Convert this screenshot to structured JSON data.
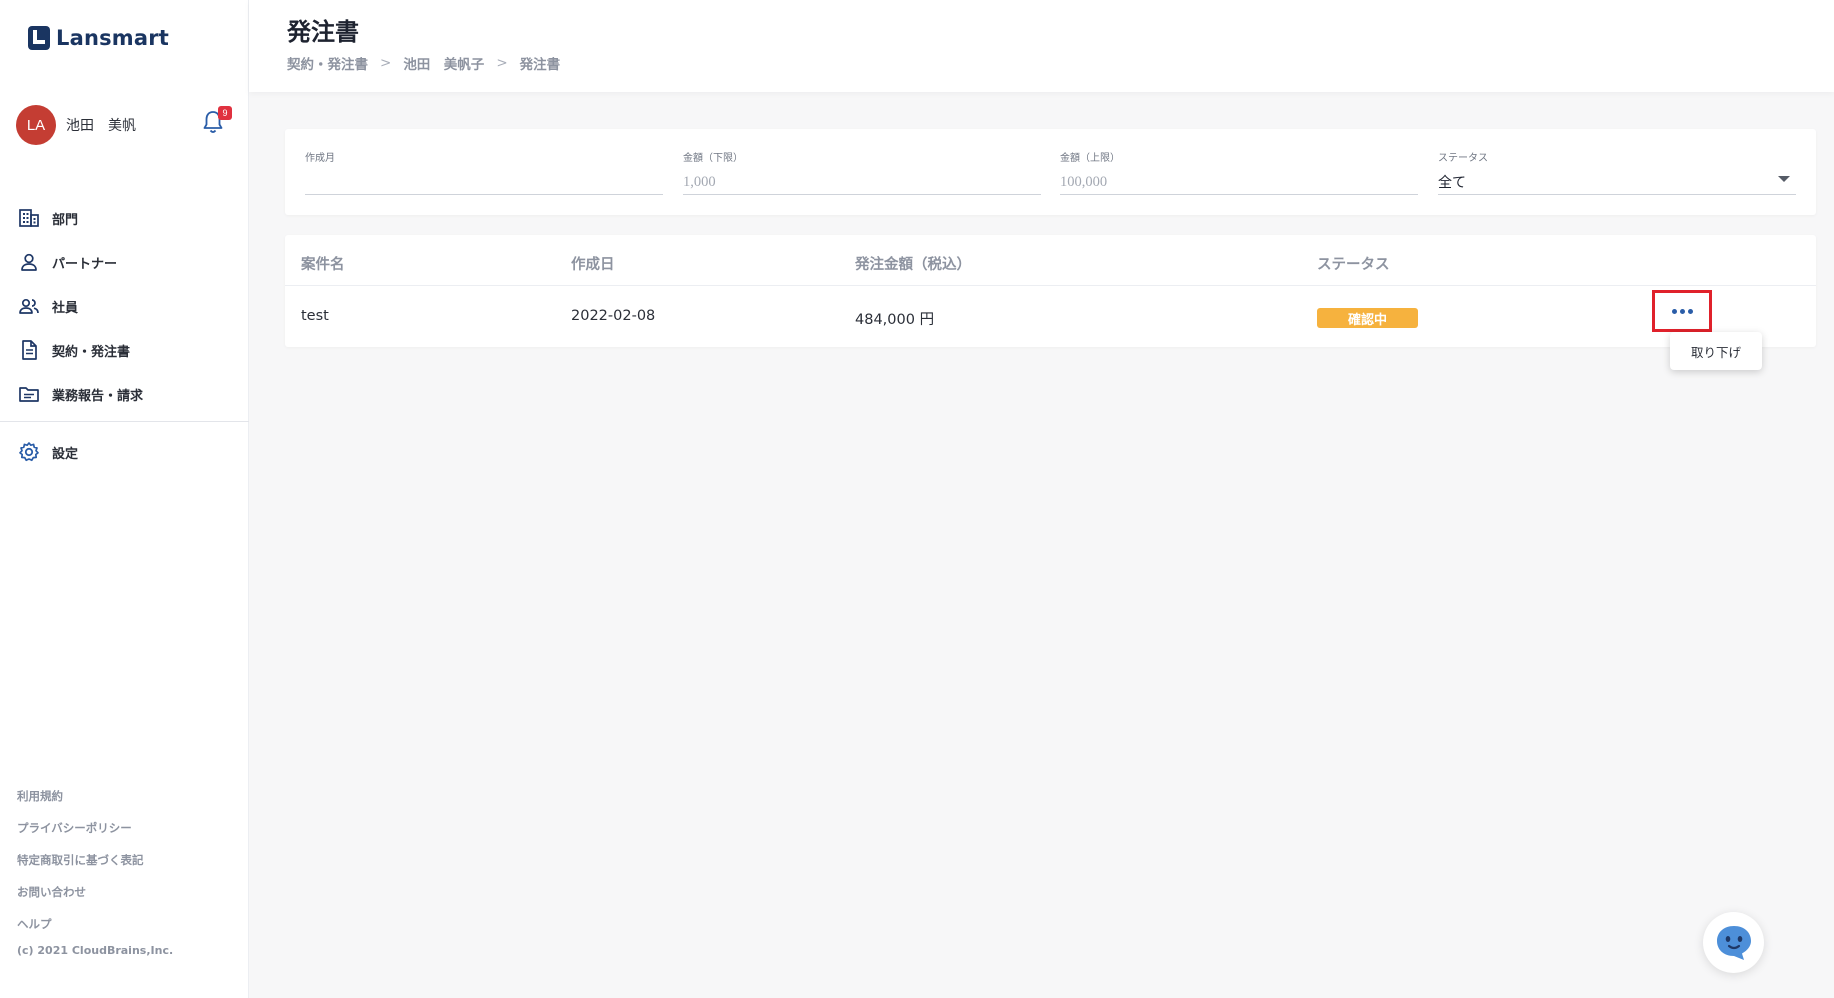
{
  "app": {
    "logo_text": "Lansmart"
  },
  "user": {
    "initials": "LA",
    "name": "池田　美帆",
    "notification_count": "9"
  },
  "nav": {
    "items": [
      {
        "label": "部門",
        "icon": "building-icon"
      },
      {
        "label": "パートナー",
        "icon": "person-icon"
      },
      {
        "label": "社員",
        "icon": "people-icon"
      },
      {
        "label": "契約・発注書",
        "icon": "document-icon"
      },
      {
        "label": "業務報告・請求",
        "icon": "folder-icon"
      }
    ],
    "settings_label": "設定"
  },
  "footer": {
    "links": [
      "利用規約",
      "プライバシーポリシー",
      "特定商取引に基づく表記",
      "お問い合わせ",
      "ヘルプ"
    ],
    "copyright": "(c) 2021 CloudBrains,Inc."
  },
  "header": {
    "title": "発注書",
    "breadcrumb": [
      "契約・発注書",
      "池田　美帆子",
      "発注書"
    ]
  },
  "filters": {
    "created_month": {
      "label": "作成月",
      "value": "",
      "placeholder": ""
    },
    "amount_min": {
      "label": "金額（下限）",
      "placeholder": "1,000"
    },
    "amount_max": {
      "label": "金額（上限）",
      "placeholder": "100,000"
    },
    "status": {
      "label": "ステータス",
      "value": "全て"
    }
  },
  "table": {
    "headers": [
      "案件名",
      "作成日",
      "発注金額（税込）",
      "ステータス"
    ],
    "rows": [
      {
        "name": "test",
        "date": "2022-02-08",
        "amount": "484,000 円",
        "status": "確認中"
      }
    ]
  },
  "row_menu": {
    "items": [
      "取り下げ"
    ]
  },
  "colors": {
    "brand": "#1a3561",
    "avatar": "#c43d33",
    "status_pending": "#f6b23e",
    "highlight_border": "#e0212b",
    "accent": "#2a5da8"
  }
}
